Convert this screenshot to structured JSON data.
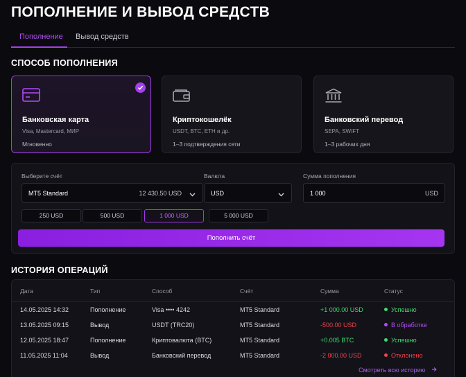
{
  "page": {
    "title": "ПОПОЛНЕНИЕ И ВЫВОД СРЕДСТВ"
  },
  "tabs": [
    {
      "label": "Пополнение",
      "active": true
    },
    {
      "label": "Вывод средств",
      "active": false
    }
  ],
  "methods_section": {
    "title": "СПОСОБ ПОПОЛНЕНИЯ"
  },
  "methods": [
    {
      "name": "Банковская карта",
      "sub": "Visa, Mastercard, МИР",
      "time": "Мгновенно",
      "icon": "credit-card-icon",
      "selected": true
    },
    {
      "name": "Криптокошелёк",
      "sub": "USDT, BTC, ETH и др.",
      "time": "1–3 подтверждения сети",
      "icon": "wallet-icon",
      "selected": false
    },
    {
      "name": "Банковский перевод",
      "sub": "SEPA, SWIFT",
      "time": "1–3 рабочих дня",
      "icon": "bank-icon",
      "selected": false
    }
  ],
  "form": {
    "account_label": "Выберите счёт",
    "account_value": "MT5 Standard",
    "account_balance": "12 430.50 USD",
    "currency_label": "Валюта",
    "currency_value": "USD",
    "amount_label": "Сумма пополнения",
    "amount_value": "1 000",
    "amount_currency": "USD",
    "quick_amounts": [
      "250 USD",
      "500 USD",
      "1 000 USD",
      "5 000 USD"
    ],
    "quick_active_index": 2,
    "submit_label": "Пополнить счёт"
  },
  "history": {
    "title": "ИСТОРИЯ ОПЕРАЦИЙ",
    "columns": [
      "Дата",
      "Тип",
      "Способ",
      "Счёт",
      "Сумма",
      "Статус"
    ],
    "rows": [
      {
        "date": "14.05.2025 14:32",
        "type": "Пополнение",
        "method": "Visa •••• 4242",
        "account": "MT5 Standard",
        "amount": "+1 000.00 USD",
        "sign": "pos",
        "status": "Успешно",
        "status_color": "#3ddb6f"
      },
      {
        "date": "13.05.2025 09:15",
        "type": "Вывод",
        "method": "USDT (TRC20)",
        "account": "MT5 Standard",
        "amount": "-500.00 USD",
        "sign": "neg",
        "status": "В обработке",
        "status_color": "#b54cf5"
      },
      {
        "date": "12.05.2025 18:47",
        "type": "Пополнение",
        "method": "Криптовалюта (BTC)",
        "account": "MT5 Standard",
        "amount": "+0.005 BTC",
        "sign": "pos",
        "status": "Успешно",
        "status_color": "#3ddb6f"
      },
      {
        "date": "11.05.2025 11:04",
        "type": "Вывод",
        "method": "Банковский перевод",
        "account": "MT5 Standard",
        "amount": "-2 000.00 USD",
        "sign": "neg",
        "status": "Отклонено",
        "status_color": "#f0434c"
      }
    ],
    "view_all_label": "Смотреть всю историю",
    "view_all_icon": "arrow-right-icon"
  },
  "colors": {
    "accent": "#a53ff0",
    "positive": "#3ddb6f",
    "negative": "#f0434c",
    "background": "#0b0a0f"
  }
}
